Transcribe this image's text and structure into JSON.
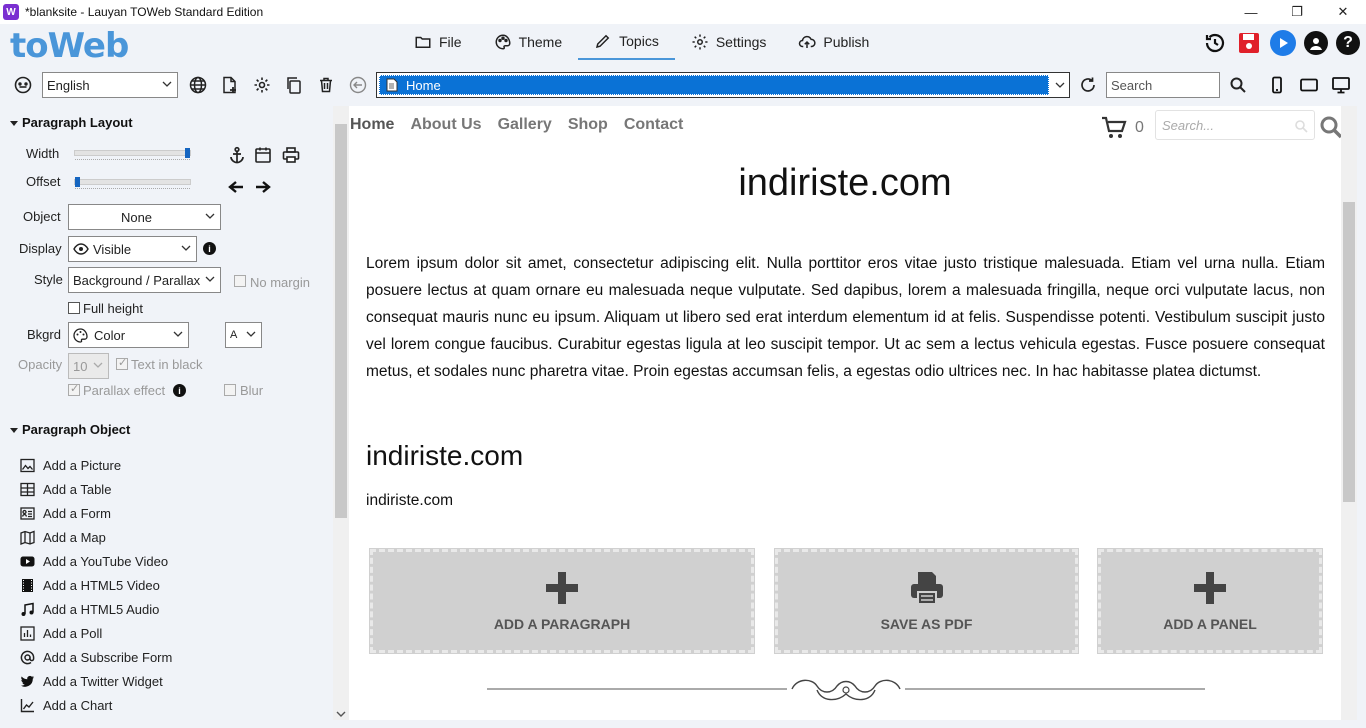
{
  "window": {
    "title": "*blanksite - Lauyan TOWeb Standard Edition",
    "app_icon_letter": "W",
    "minimize": "—",
    "restore": "❐",
    "close": "✕"
  },
  "logo": "toWeb",
  "tabs": [
    {
      "label": "File",
      "icon": "folder-icon"
    },
    {
      "label": "Theme",
      "icon": "palette-icon"
    },
    {
      "label": "Topics",
      "icon": "pencil-icon",
      "active": true
    },
    {
      "label": "Settings",
      "icon": "gear-icon"
    },
    {
      "label": "Publish",
      "icon": "cloud-upload-icon"
    }
  ],
  "toolbar2": {
    "language": "English",
    "address": "Home",
    "search_placeholder": "Search"
  },
  "paragraph_layout": {
    "title": "Paragraph Layout",
    "width_label": "Width",
    "width_value": 1.0,
    "offset_label": "Offset",
    "offset_value": 0.0,
    "object_label": "Object",
    "object_value": "None",
    "display_label": "Display",
    "display_value": "Visible",
    "style_label": "Style",
    "style_value": "Background / Parallax",
    "no_margin": "No margin",
    "full_height": "Full height",
    "bkgrd_label": "Bkgrd",
    "bkgrd_value": "Color",
    "font_value": "A",
    "opacity_label": "Opacity",
    "opacity_value": "10",
    "text_in_black": "Text in black",
    "parallax_effect": "Parallax effect",
    "blur": "Blur"
  },
  "paragraph_object": {
    "title": "Paragraph Object",
    "items": [
      {
        "label": "Add a Picture",
        "icon": "picture-icon"
      },
      {
        "label": "Add a Table",
        "icon": "table-icon"
      },
      {
        "label": "Add a Form",
        "icon": "form-icon"
      },
      {
        "label": "Add a Map",
        "icon": "map-icon"
      },
      {
        "label": "Add a YouTube Video",
        "icon": "youtube-icon"
      },
      {
        "label": "Add a HTML5 Video",
        "icon": "film-icon"
      },
      {
        "label": "Add a HTML5 Audio",
        "icon": "music-icon"
      },
      {
        "label": "Add a Poll",
        "icon": "poll-icon"
      },
      {
        "label": "Add a Subscribe Form",
        "icon": "at-icon"
      },
      {
        "label": "Add a Twitter Widget",
        "icon": "twitter-icon"
      },
      {
        "label": "Add a Chart",
        "icon": "chart-icon"
      }
    ]
  },
  "preview": {
    "nav": [
      "Home",
      "About Us",
      "Gallery",
      "Shop",
      "Contact"
    ],
    "cart_count": "0",
    "search_placeholder": "Search...",
    "heading": "indiriste.com",
    "paragraph": "Lorem ipsum dolor sit amet, consectetur adipiscing elit. Nulla porttitor eros vitae justo tristique malesuada. Etiam vel urna nulla. Etiam posuere lectus at quam ornare eu malesuada neque vulputate. Sed dapibus, lorem a malesuada fringilla, neque orci vulputate lacus, non consequat mauris nunc eu ipsum. Aliquam ut libero sed erat interdum elementum id at felis. Suspendisse potenti. Vestibulum suscipit justo vel lorem congue faucibus. Curabitur egestas ligula at leo suscipit tempor. Ut ac sem a lectus vehicula egestas. Fusce posuere consequat metus, et sodales nunc pharetra vitae. Proin egestas accumsan felis, a egestas odio ultrices nec. In hac habitasse platea dictumst.",
    "subheading": "indiriste.com",
    "small_text": "indiriste.com",
    "buttons": [
      "ADD A PARAGRAPH",
      "SAVE AS PDF",
      "ADD A PANEL"
    ]
  },
  "colors": {
    "accent": "#4a96d9",
    "selection": "#0a72d6",
    "save_red": "#e0202a",
    "preview_blue": "#1e7ce8"
  }
}
